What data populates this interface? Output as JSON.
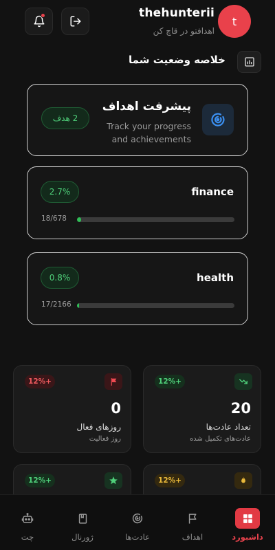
{
  "header": {
    "username": "thehunterii",
    "tagline": "اهدافتو در قاچ کن",
    "avatar_letter": "t"
  },
  "summary": {
    "title": "خلاصه وضعیت شما"
  },
  "goals_card": {
    "title": "پیشرفت اهداف",
    "subtitle": "Track your progress and achievements",
    "badge": "2 هدف"
  },
  "goals": [
    {
      "name": "finance",
      "percent_label": "2.7%",
      "count_label": "18/678",
      "progress": 0.027
    },
    {
      "name": "health",
      "percent_label": "0.8%",
      "count_label": "17/2166",
      "progress": 0.008
    }
  ],
  "stats": [
    {
      "value": "0",
      "label": "روزهای فعال",
      "sublabel": "روز فعالیت",
      "change": "12%+",
      "tone": "red",
      "icon": "flag-icon"
    },
    {
      "value": "20",
      "label": "تعداد عادت‌ها",
      "sublabel": "عادت‌های تکمیل شده",
      "change": "12%+",
      "tone": "green",
      "icon": "trend-icon"
    },
    {
      "value": "",
      "label": "",
      "sublabel": "",
      "change": "12%+",
      "tone": "green",
      "icon": "star-icon"
    },
    {
      "value": "",
      "label": "",
      "sublabel": "",
      "change": "12%+",
      "tone": "yellow",
      "icon": "fire-icon"
    }
  ],
  "nav": {
    "items": [
      {
        "label": "چت",
        "icon": "robot-icon"
      },
      {
        "label": "ژورنال",
        "icon": "book-icon"
      },
      {
        "label": "عادت‌ها",
        "icon": "target-icon"
      },
      {
        "label": "اهداف",
        "icon": "flag-outline-icon"
      },
      {
        "label": "داشبورد",
        "icon": "dashboard-icon",
        "active": true
      }
    ]
  },
  "colors": {
    "accent": "#e9414b",
    "success": "#2fbe56",
    "background": "#121212"
  }
}
